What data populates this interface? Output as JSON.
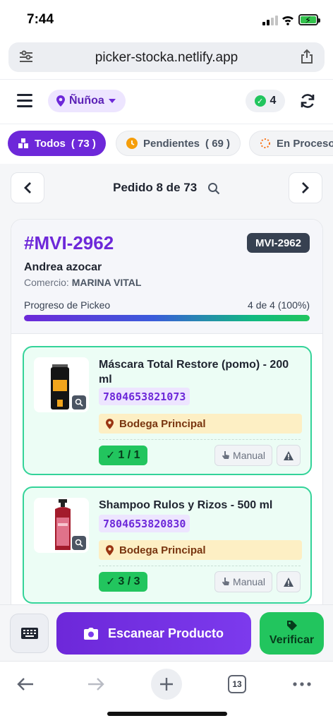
{
  "status_bar": {
    "time": "7:44"
  },
  "browser": {
    "url": "picker-stocka.netlify.app",
    "tab_count": "13"
  },
  "header": {
    "location": "Ñuñoa",
    "done_count": "4"
  },
  "filters": [
    {
      "label": "Todos",
      "count": "73",
      "icon": "boxes-icon",
      "color": "#6d28d9"
    },
    {
      "label": "Pendientes",
      "count": "69",
      "icon": "clock-icon",
      "color": "#f59e0b"
    },
    {
      "label": "En Proceso",
      "icon": "spinner-icon",
      "color": "#f97316"
    }
  ],
  "order_nav": {
    "title": "Pedido 8 de 73"
  },
  "order": {
    "id": "#MVI-2962",
    "tag": "MVI-2962",
    "customer": "Andrea azocar",
    "commerce_label": "Comercio:",
    "commerce": "MARINA VITAL",
    "progress_label": "Progreso de Pickeo",
    "progress_text": "4 de 4 (100%)",
    "progress_fraction": 1.0
  },
  "items": [
    {
      "name": "Máscara Total Restore (pomo) - 200 ml",
      "sku": "7804653821073",
      "location": "Bodega Principal",
      "qty": "1 / 1",
      "manual_label": "Manual"
    },
    {
      "name": "Shampoo Rulos y Rizos - 500 ml",
      "sku": "7804653820830",
      "location": "Bodega Principal",
      "qty": "3 / 3",
      "manual_label": "Manual"
    }
  ],
  "actions": {
    "scan_label": "Escanear Producto",
    "verify_label": "Verificar"
  },
  "colors": {
    "brand": "#6d28d9",
    "success": "#22c55e",
    "location_bg": "#fdefc4"
  }
}
